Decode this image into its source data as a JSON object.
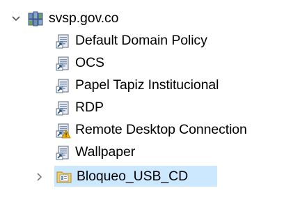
{
  "tree": {
    "root": {
      "label": "svsp.gov.co",
      "expanded": true,
      "icon": "domain-icon"
    },
    "items": [
      {
        "label": "Default Domain Policy",
        "icon": "gpo-link-icon"
      },
      {
        "label": "OCS",
        "icon": "gpo-link-icon"
      },
      {
        "label": "Papel Tapiz Institucional",
        "icon": "gpo-link-icon"
      },
      {
        "label": "RDP",
        "icon": "gpo-link-icon"
      },
      {
        "label": "Remote Desktop Connection",
        "icon": "gpo-link-warning-icon"
      },
      {
        "label": "Wallpaper",
        "icon": "gpo-link-icon"
      }
    ],
    "ou": {
      "label": "Bloqueo_USB_CD",
      "expanded": false,
      "selected": true,
      "icon": "organizational-unit-icon"
    }
  },
  "colors": {
    "selection": "#cce8ff",
    "chevron": "#7a7a7a",
    "gpo_paper": "#e9eef5",
    "link_arrow": "#1e4f91",
    "warning": "#f0b400"
  }
}
